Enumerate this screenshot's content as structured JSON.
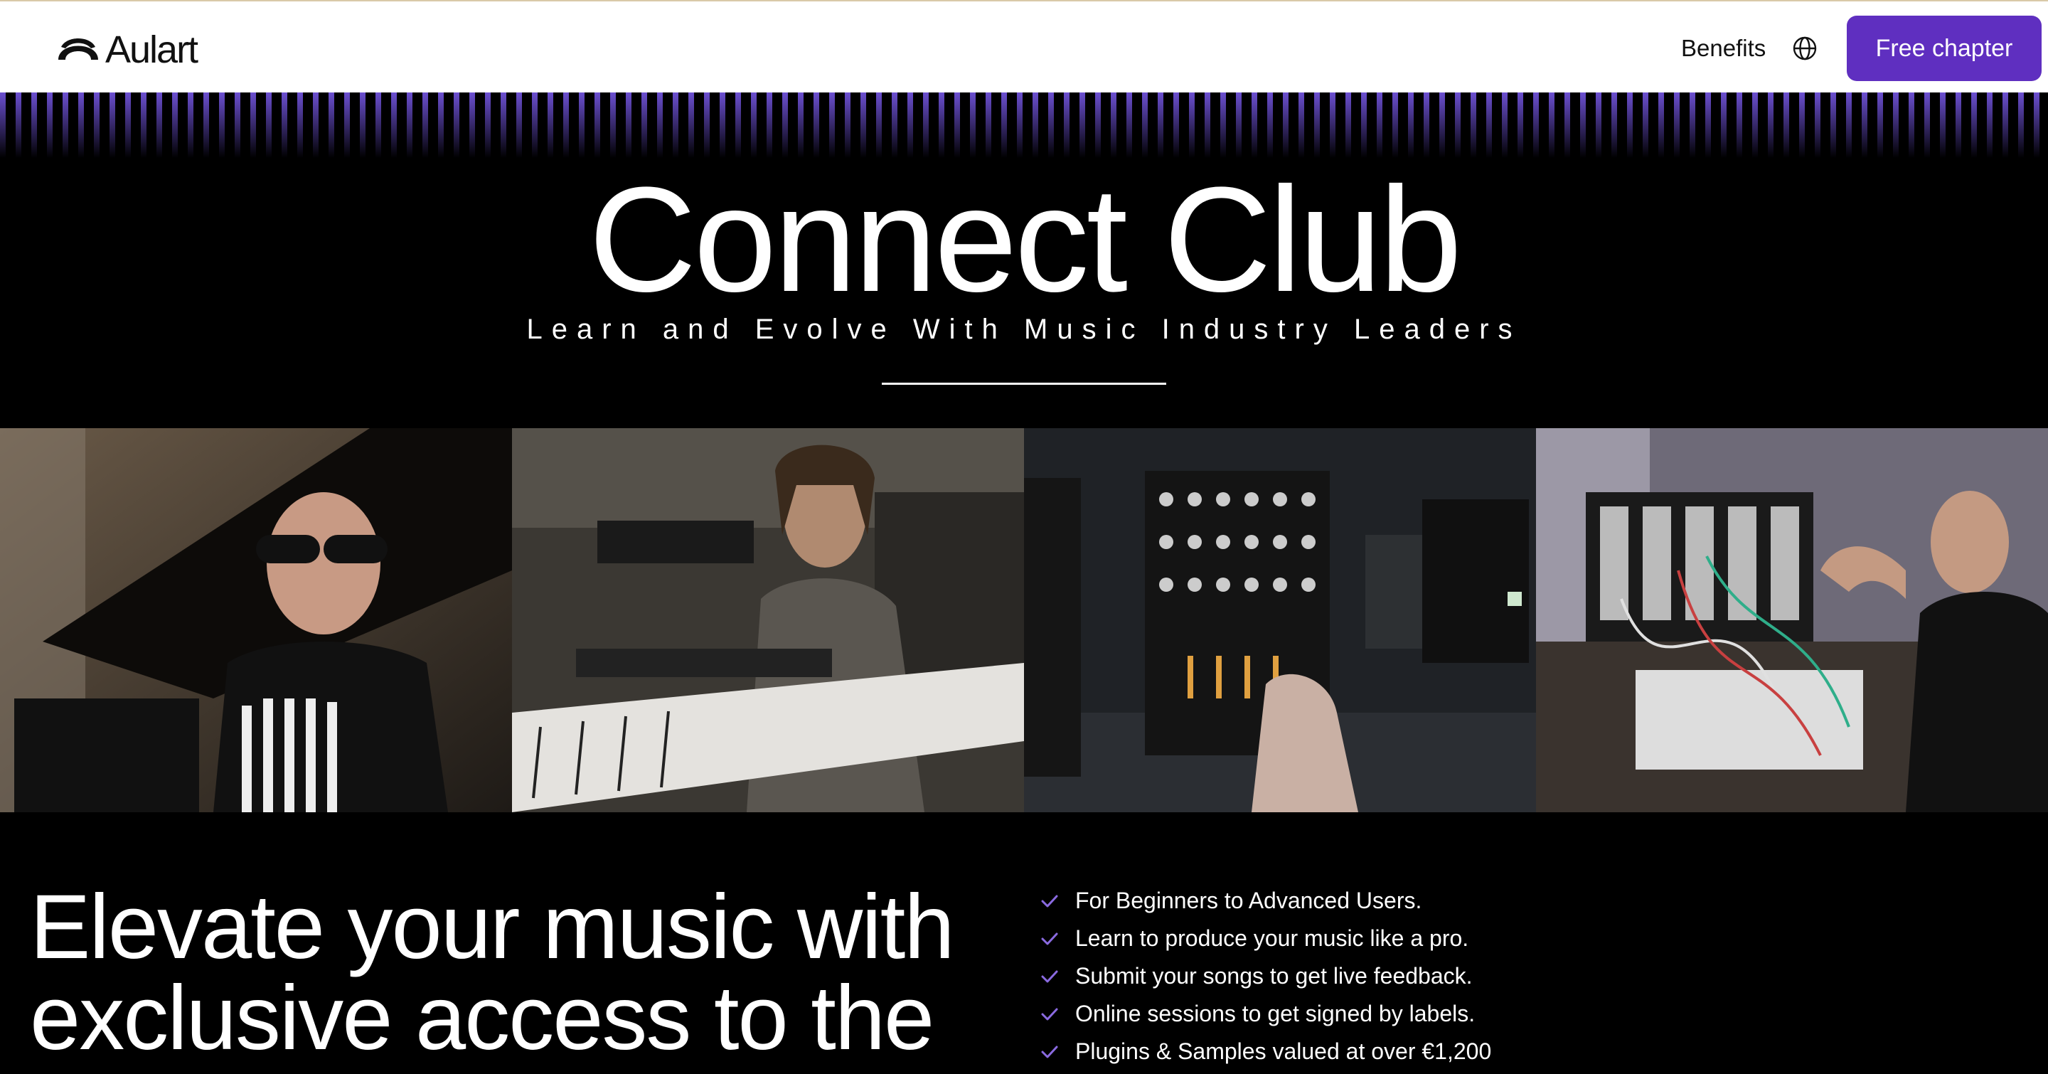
{
  "header": {
    "brand": "Aulart",
    "nav_benefits": "Benefits",
    "globe_icon": "globe-icon",
    "cta_label": "Free chapter",
    "accent_color": "#5f2fc0"
  },
  "hero": {
    "title": "Connect Club",
    "subtitle": "Learn and Evolve With Music Industry Leaders"
  },
  "images": [
    {
      "name": "artist-at-piano-photo"
    },
    {
      "name": "keyboardist-in-studio-photo"
    },
    {
      "name": "dj-mixer-photo"
    },
    {
      "name": "modular-synth-photo"
    }
  ],
  "main": {
    "headline_line1": "Elevate your music with",
    "headline_line2": "exclusive access to the",
    "features": [
      "For Beginners to Advanced Users.",
      "Learn to produce your music like a pro.",
      "Submit your songs to get live feedback.",
      "Online sessions to get signed by labels.",
      "Plugins & Samples valued at over €1,200"
    ],
    "check_icon": "check-icon"
  }
}
